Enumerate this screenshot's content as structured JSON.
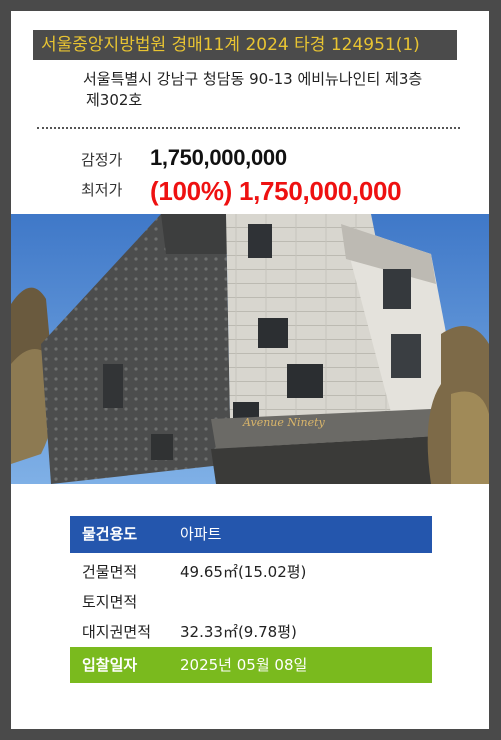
{
  "title": "서울중앙지방법원 경매11계 2024 타경 124951(1)",
  "address": {
    "line1": "서울특별시 강남구 청담동 90-13 에비뉴나인티 제3층",
    "line2": "제302호"
  },
  "price": {
    "appraisal_label": "감정가",
    "appraisal_value": "1,750,000,000",
    "minimum_label": "최저가",
    "minimum_value": "(100%) 1,750,000,000"
  },
  "photo": {
    "sign_text": "Avenue Ninety"
  },
  "details": [
    {
      "key": "물건용도",
      "value": "아파트"
    },
    {
      "key": "건물면적",
      "value": "49.65㎡(15.02평)"
    },
    {
      "key": "토지면적",
      "value": ""
    },
    {
      "key": "대지권면적",
      "value": "32.33㎡(9.78평)"
    },
    {
      "key": "입찰일자",
      "value": "2025년 05월 08일"
    }
  ],
  "colors": {
    "title_bg": "#4b4b4b",
    "title_text": "#e8c432",
    "min_price": "#ee1111",
    "usage_row": "#2456ad",
    "bid_row": "#7aba1e"
  }
}
